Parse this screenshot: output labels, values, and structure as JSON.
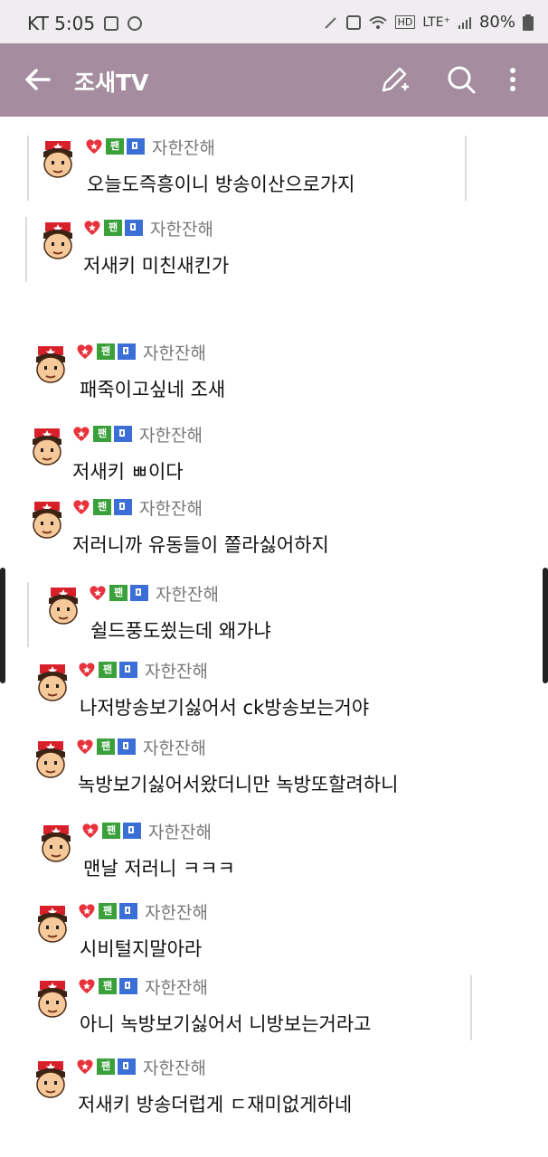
{
  "status": {
    "carrier_time": "KT 5:05",
    "network": "LTE⁺",
    "battery": "80%"
  },
  "app_bar": {
    "title": "조새TV"
  },
  "messages": [
    {
      "fan": "팬",
      "nick": "자한잔해",
      "text": "오늘도즉흥이니 방송이산으로가지"
    },
    {
      "fan": "팬",
      "nick": "자한잔해",
      "text": "저새키 미친새킨가"
    },
    {
      "fan": "팬",
      "nick": "자한잔해",
      "text": "패죽이고싶네 조새"
    },
    {
      "fan": "팬",
      "nick": "자한잔해",
      "text": "저새키 ㅃ이다"
    },
    {
      "fan": "팬",
      "nick": "자한잔해",
      "text": "저러니까 유동들이 쫄라싫어하지"
    },
    {
      "fan": "팬",
      "nick": "자한잔해",
      "text": "쉴드풍도쑀는데 왜가냐"
    },
    {
      "fan": "팬",
      "nick": "자한잔해",
      "text": "나저방송보기싫어서 ck방송보는거야"
    },
    {
      "fan": "팬",
      "nick": "자한잔해",
      "text": "녹방보기싫어서왔더니만 녹방또할려하니"
    },
    {
      "fan": "팬",
      "nick": "자한잔해",
      "text": "맨날 저러니 ㅋㅋㅋ"
    },
    {
      "fan": "팬",
      "nick": "자한잔해",
      "text": "시비털지말아라"
    },
    {
      "fan": "팬",
      "nick": "자한잔해",
      "text": "아니 녹방보기싫어서 니방보는거라고"
    },
    {
      "fan": "팬",
      "nick": "자한잔해",
      "text": "저새키 방송더럽게 ㄷ재미없게하네"
    }
  ],
  "colors": {
    "app_bar": "#a58d9f",
    "status_bar": "#efedef",
    "fan_badge": "#3aa03a",
    "subscribe_badge": "#3c6fd6",
    "heart_badge": "#e8323c"
  }
}
